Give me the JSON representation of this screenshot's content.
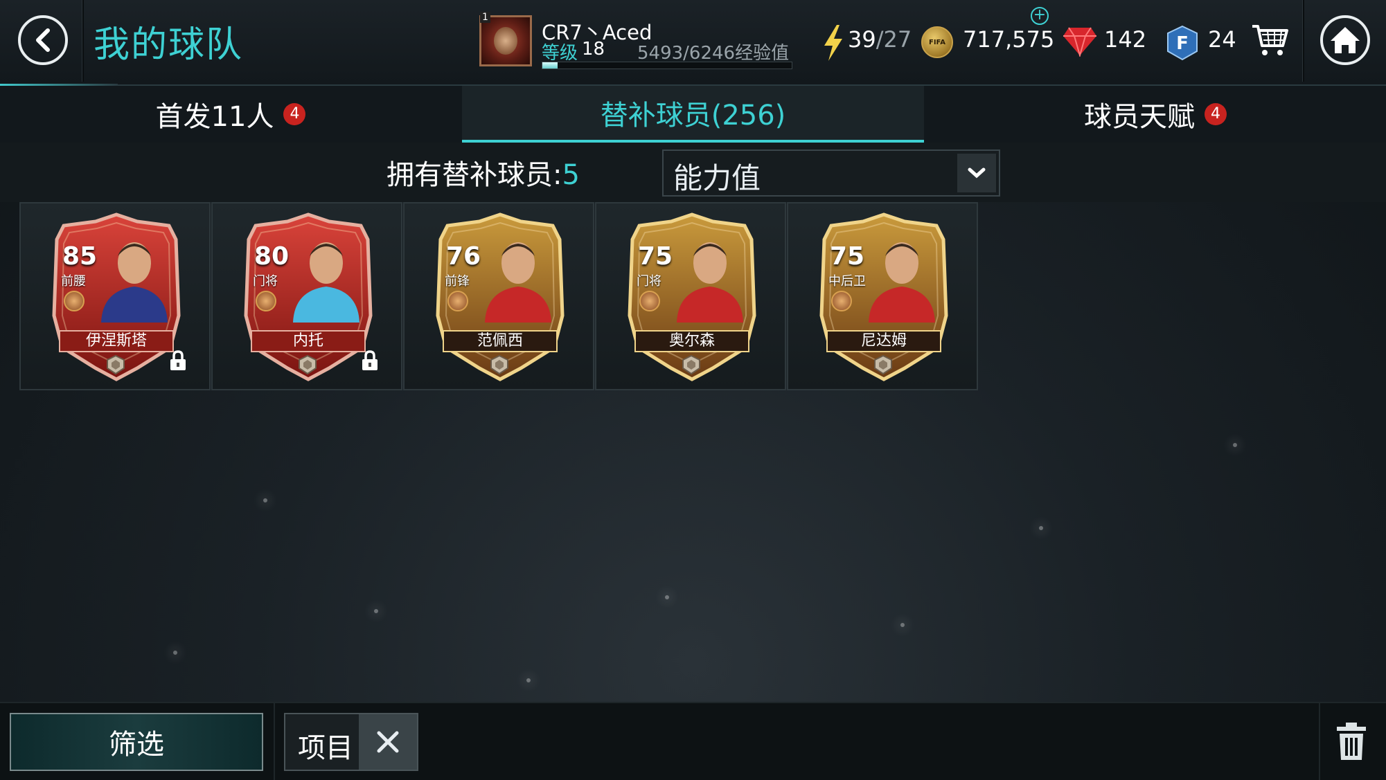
{
  "header": {
    "title": "我的球队",
    "player_name": "CR7丶Aced",
    "rank": "1",
    "level_label": "等级",
    "level": "18",
    "xp_text": "5493/6246经验值",
    "xp_fraction": 0.06,
    "energy_current": "39",
    "energy_max": "/27",
    "coins": "717,575",
    "gems": "142",
    "fifa_points": "24"
  },
  "tabs": [
    {
      "label": "首发11人",
      "badge": "4"
    },
    {
      "label": "替补球员(256)",
      "badge": ""
    },
    {
      "label": "球员天赋",
      "badge": "4"
    }
  ],
  "subs": {
    "count_label": "拥有替补球员:",
    "count": "5",
    "sort_value": "能力值"
  },
  "cards": [
    {
      "rating": "85",
      "position": "前腰",
      "name": "伊涅斯塔",
      "style": "red",
      "locked": true
    },
    {
      "rating": "80",
      "position": "门将",
      "name": "内托",
      "style": "red",
      "locked": true
    },
    {
      "rating": "76",
      "position": "前锋",
      "name": "范佩西",
      "style": "gold",
      "locked": false
    },
    {
      "rating": "75",
      "position": "门将",
      "name": "奥尔森",
      "style": "gold",
      "locked": false
    },
    {
      "rating": "75",
      "position": "中后卫",
      "name": "尼达姆",
      "style": "gold",
      "locked": false
    }
  ],
  "bottom": {
    "filter_label": "筛选",
    "chip_label": "项目"
  },
  "colors": {
    "accent": "#3ed1d3",
    "badge": "#c8231f"
  }
}
